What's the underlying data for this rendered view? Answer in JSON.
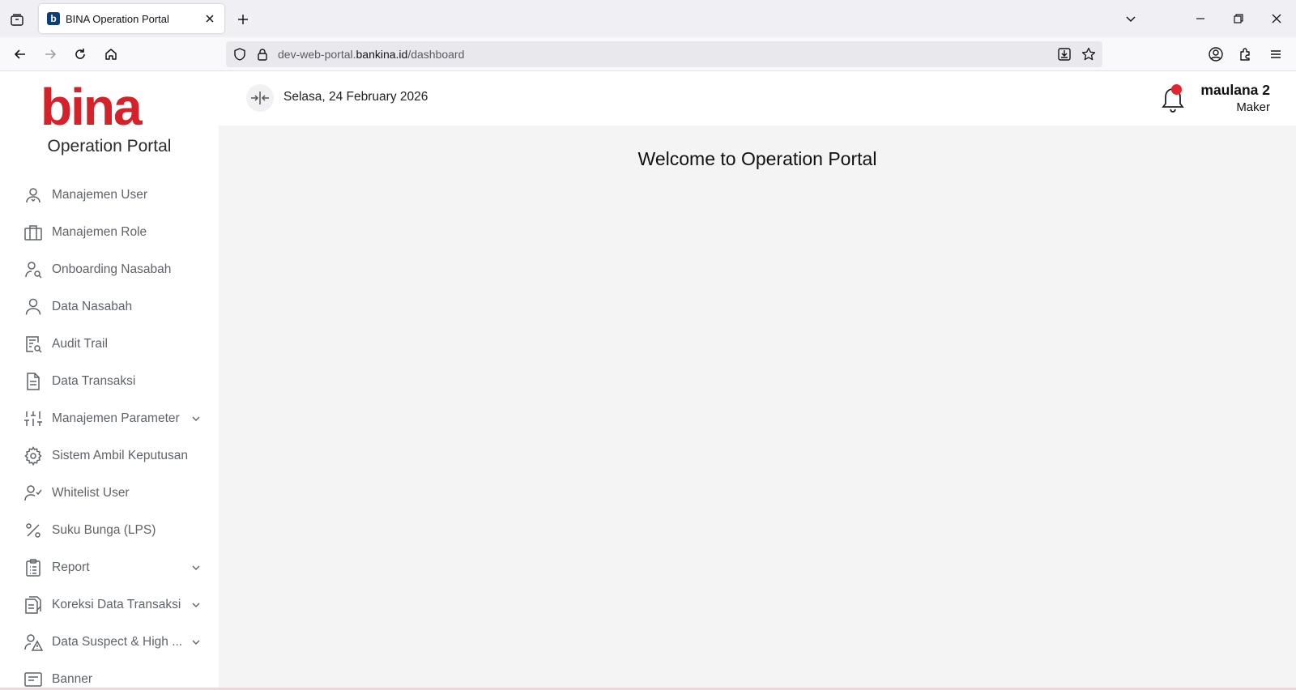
{
  "browser": {
    "tab_title": "BINA Operation Portal",
    "tab_favicon_letter": "b",
    "url_prefix": "dev-web-portal.",
    "url_domain": "bankina.id",
    "url_path": "/dashboard"
  },
  "brand": {
    "logo_text": "bina",
    "logo_color": "#d3222a",
    "portal_name": "Operation Portal"
  },
  "sidebar": {
    "items": [
      {
        "label": "Manajemen User",
        "icon": "user-management-icon",
        "has_submenu": false
      },
      {
        "label": "Manajemen Role",
        "icon": "briefcase-icon",
        "has_submenu": false
      },
      {
        "label": "Onboarding Nasabah",
        "icon": "user-search-icon",
        "has_submenu": false
      },
      {
        "label": "Data Nasabah",
        "icon": "user-icon",
        "has_submenu": false
      },
      {
        "label": "Audit Trail",
        "icon": "document-search-icon",
        "has_submenu": false
      },
      {
        "label": "Data Transaksi",
        "icon": "document-icon",
        "has_submenu": false
      },
      {
        "label": "Manajemen Parameter",
        "icon": "sliders-icon",
        "has_submenu": true
      },
      {
        "label": "Sistem Ambil Keputusan",
        "icon": "gear-icon",
        "has_submenu": false
      },
      {
        "label": "Whitelist User",
        "icon": "user-check-icon",
        "has_submenu": false
      },
      {
        "label": "Suku Bunga (LPS)",
        "icon": "percent-icon",
        "has_submenu": false
      },
      {
        "label": "Report",
        "icon": "clipboard-list-icon",
        "has_submenu": true
      },
      {
        "label": "Koreksi Data Transaksi",
        "icon": "documents-edit-icon",
        "has_submenu": true
      },
      {
        "label": "Data Suspect & High ...",
        "icon": "user-warning-icon",
        "has_submenu": true
      },
      {
        "label": "Banner",
        "icon": "banner-icon",
        "has_submenu": false
      }
    ]
  },
  "header": {
    "date": "Selasa, 24 February 2026",
    "user_name": "maulana 2",
    "user_role": "Maker",
    "notification_dot_color": "#e0262e"
  },
  "main": {
    "welcome": "Welcome to Operation Portal"
  }
}
